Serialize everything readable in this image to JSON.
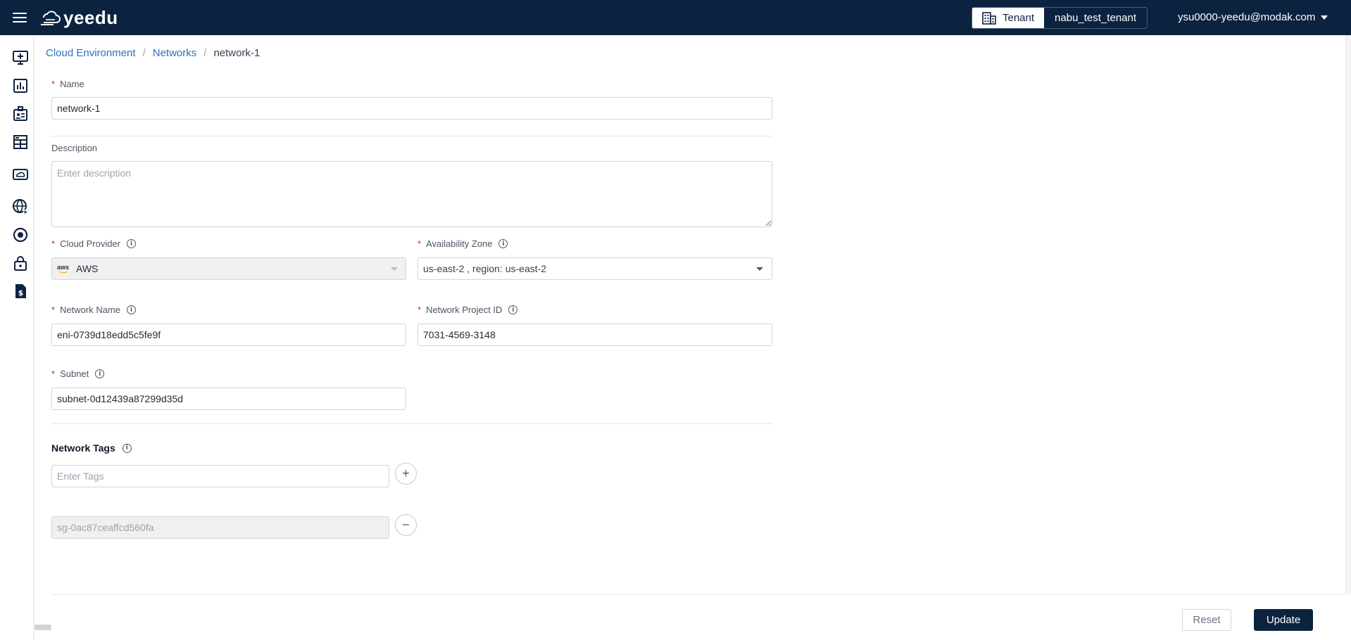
{
  "header": {
    "logo_text": "yeedu",
    "tenant_label": "Tenant",
    "tenant_value": "nabu_test_tenant",
    "user_email": "ysu0000-yeedu@modak.com"
  },
  "sidebar": {
    "items": [
      {
        "icon": "add-monitor-icon"
      },
      {
        "icon": "chart-icon"
      },
      {
        "icon": "id-card-icon"
      },
      {
        "icon": "grid-layout-icon"
      },
      {
        "icon": "cloud-drive-icon"
      },
      {
        "icon": "globe-icon"
      },
      {
        "icon": "target-icon"
      },
      {
        "icon": "lock-icon"
      },
      {
        "icon": "billing-icon"
      }
    ]
  },
  "breadcrumb": {
    "items": [
      "Cloud Environment",
      "Networks"
    ],
    "current": "network-1",
    "separator": "/"
  },
  "form": {
    "name_label": "Name",
    "name_value": "network-1",
    "description_label": "Description",
    "description_placeholder": "Enter description",
    "cloud_provider_label": "Cloud Provider",
    "cloud_provider_badge": "aws",
    "cloud_provider_value": "AWS",
    "availability_zone_label": "Availability Zone",
    "availability_zone_value": "us-east-2 , region: us-east-2",
    "network_name_label": "Network Name",
    "network_name_value": "eni-0739d18edd5c5fe9f",
    "network_project_id_label": "Network Project ID",
    "network_project_id_value": "7031-4569-3148",
    "subnet_label": "Subnet",
    "subnet_value": "subnet-0d12439a87299d35d",
    "required_mark": "*",
    "info_glyph": "i"
  },
  "tags": {
    "title": "Network Tags",
    "input_placeholder": "Enter Tags",
    "add_glyph": "+",
    "remove_glyph": "−",
    "items": [
      "sg-0ac87ceaffcd560fa"
    ]
  },
  "actions": {
    "reset_label": "Reset",
    "update_label": "Update"
  },
  "colors": {
    "brand_navy": "#0c2340",
    "link_blue": "#2f6fbf",
    "required_red": "#e11d48"
  }
}
